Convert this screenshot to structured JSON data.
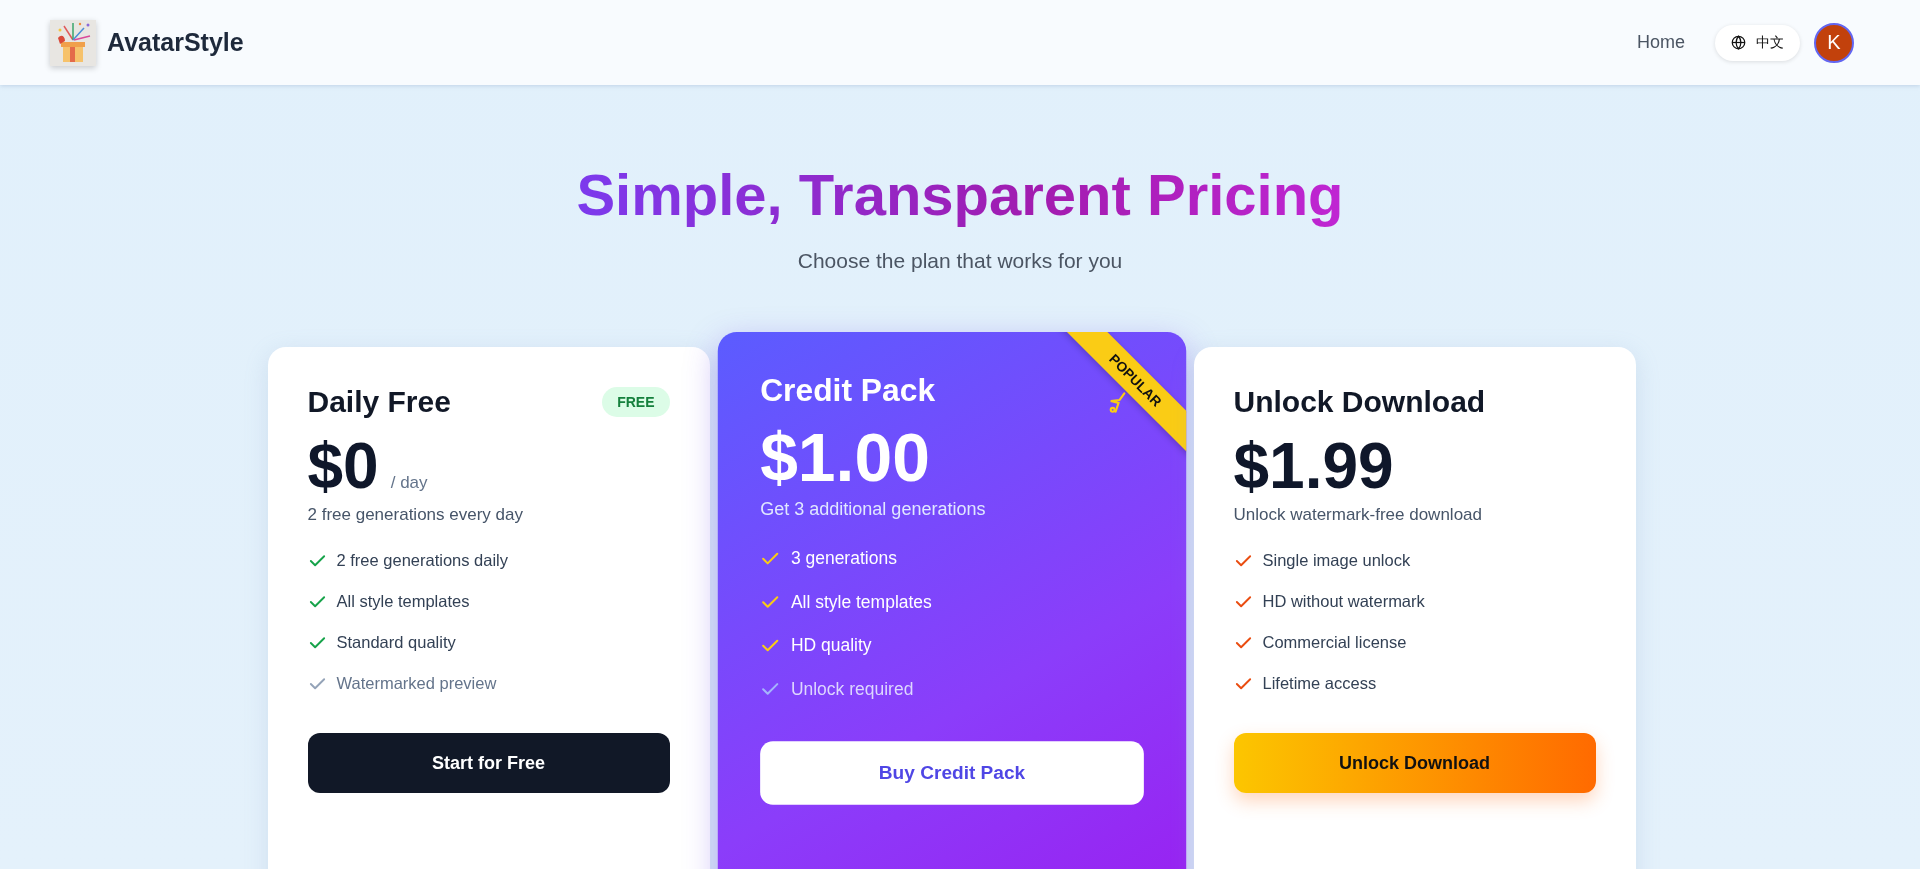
{
  "header": {
    "brand": "AvatarStyle",
    "nav": [
      {
        "label": "Home"
      }
    ],
    "language": {
      "label": "中文"
    },
    "avatar": {
      "initial": "K"
    }
  },
  "hero": {
    "title": "Simple, Transparent Pricing",
    "subtitle": "Choose the plan that works for you"
  },
  "plans": [
    {
      "kind": "free",
      "name": "Daily Free",
      "badge": "FREE",
      "price": "$0",
      "period": "/ day",
      "description": "2 free generations every day",
      "features": [
        {
          "label": "2 free generations daily",
          "included": true
        },
        {
          "label": "All style templates",
          "included": true
        },
        {
          "label": "Standard quality",
          "included": true
        },
        {
          "label": "Watermarked preview",
          "included": false
        }
      ],
      "button": "Start for Free"
    },
    {
      "kind": "popular",
      "name": "Credit Pack",
      "ribbon": "POPULAR",
      "price": "$1.00",
      "description": "Get 3 additional generations",
      "features": [
        {
          "label": "3 generations",
          "included": true
        },
        {
          "label": "All style templates",
          "included": true
        },
        {
          "label": "HD quality",
          "included": true
        },
        {
          "label": "Unlock required",
          "included": false
        }
      ],
      "button": "Buy Credit Pack"
    },
    {
      "kind": "premium",
      "name": "Unlock Download",
      "price": "$1.99",
      "description": "Unlock watermark-free download",
      "features": [
        {
          "label": "Single image unlock",
          "included": true
        },
        {
          "label": "HD without watermark",
          "included": true
        },
        {
          "label": "Commercial license",
          "included": true
        },
        {
          "label": "Lifetime access",
          "included": true
        }
      ],
      "button": "Unlock Download"
    }
  ]
}
